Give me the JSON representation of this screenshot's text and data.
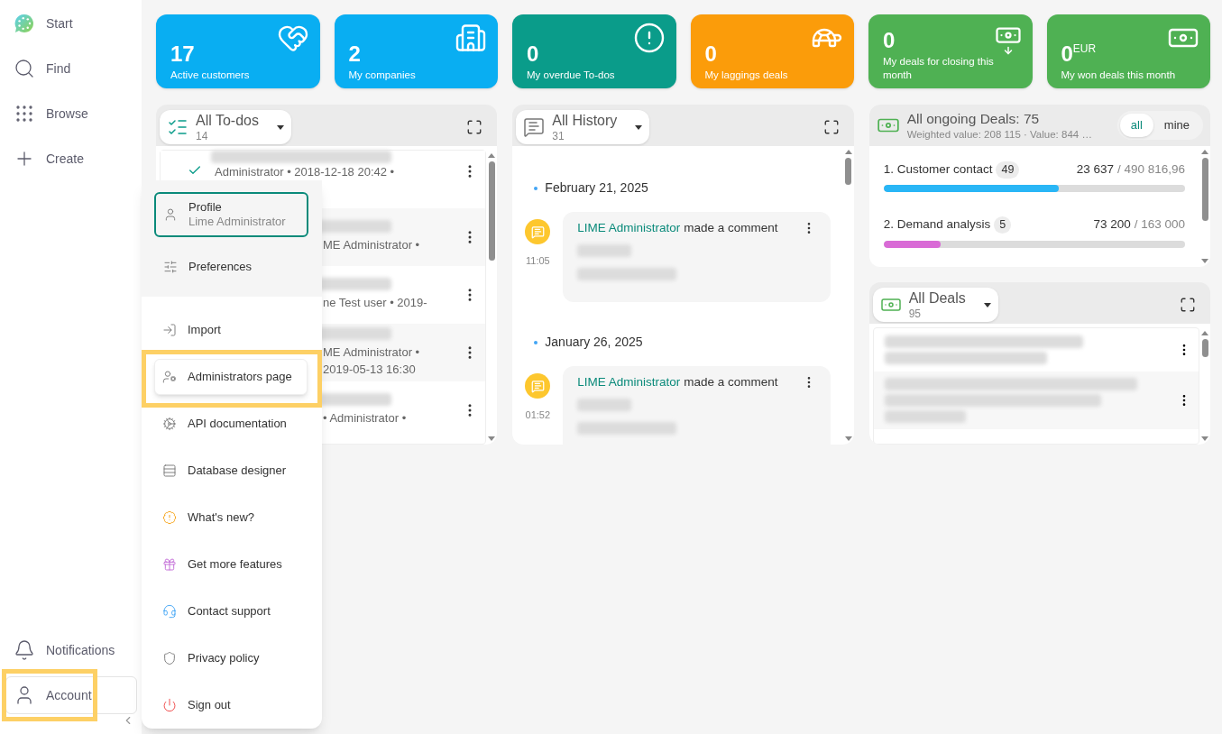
{
  "sidebar": {
    "items": [
      {
        "label": "Start",
        "selected": false,
        "highlighted": false
      },
      {
        "label": "Find",
        "selected": false,
        "highlighted": false
      },
      {
        "label": "Browse",
        "selected": false,
        "highlighted": false
      },
      {
        "label": "Create",
        "selected": false,
        "highlighted": false
      }
    ],
    "bottom_items": [
      {
        "label": "Notifications",
        "selected": false,
        "highlighted": false
      },
      {
        "label": "Account",
        "selected": true,
        "highlighted": true
      }
    ]
  },
  "kpis": [
    {
      "value": "17",
      "label": "Active customers",
      "color": "#09aef2"
    },
    {
      "value": "2",
      "label": "My companies",
      "color": "#09aef2"
    },
    {
      "value": "0",
      "label": "My overdue To-dos",
      "color": "#0a9c8a"
    },
    {
      "value": "0",
      "label": "My laggings deals",
      "color": "#fb9c0a"
    },
    {
      "value": "0",
      "label": "My deals for closing this month",
      "color": "#4fb153"
    },
    {
      "value": "0",
      "unit": "EUR",
      "label": "My won deals this month",
      "color": "#4fb153"
    }
  ],
  "todos": {
    "title": "All To-dos",
    "count": "14",
    "rows": [
      {
        "text": "Administrator • 2018-12-18 20:42 •"
      },
      {
        "text": "ME Administrator •"
      },
      {
        "text": "ne Test user • 2019-"
      },
      {
        "text": "ME Administrator • 2019-05-13 16:30"
      },
      {
        "text": "• Administrator •"
      }
    ]
  },
  "history": {
    "title": "All History",
    "count": "31",
    "groups": [
      {
        "date": "February 21, 2025",
        "entries": [
          {
            "author": "LIME Administrator",
            "action": "made a comment",
            "time": "11:05"
          }
        ]
      },
      {
        "date": "January 26, 2025",
        "entries": [
          {
            "author": "LIME Administrator",
            "action": "made a comment",
            "time": "01:52"
          }
        ]
      }
    ]
  },
  "ongoing_deals": {
    "title": "All ongoing Deals: 75",
    "subtitle": "Weighted value: 208 115 · Value: 844 …",
    "filters": [
      {
        "label": "all",
        "selected": true
      },
      {
        "label": "mine",
        "selected": false
      }
    ],
    "stages": [
      {
        "name": "1. Customer contact",
        "count": "49",
        "value": "23 637",
        "total": "/ 490 816,96",
        "level": 0.58,
        "color": "#29b6f6"
      },
      {
        "name": "2. Demand analysis",
        "count": "5",
        "value": "73 200",
        "total": "/ 163 000",
        "level": 0.19,
        "color": "#d96bd6"
      }
    ]
  },
  "all_deals": {
    "title": "All Deals",
    "count": "95"
  },
  "account_menu": {
    "header_items": [
      {
        "label": "Profile",
        "sublabel": "Lime Administrator",
        "selected": true,
        "highlighted": false
      },
      {
        "label": "Preferences",
        "selected": false,
        "highlighted": false
      }
    ],
    "items": [
      {
        "label": "Import",
        "selected": false,
        "highlighted": false
      },
      {
        "label": "Administrators page",
        "selected": false,
        "highlighted": true
      },
      {
        "label": "API documentation",
        "selected": false,
        "highlighted": false
      },
      {
        "label": "Database designer",
        "selected": false,
        "highlighted": false
      },
      {
        "label": "What's new?",
        "selected": false,
        "highlighted": false
      },
      {
        "label": "Get more features",
        "selected": false,
        "highlighted": false
      },
      {
        "label": "Contact support",
        "selected": false,
        "highlighted": false
      },
      {
        "label": "Privacy policy",
        "selected": false,
        "highlighted": false
      },
      {
        "label": "Sign out",
        "selected": false,
        "highlighted": false
      }
    ]
  }
}
